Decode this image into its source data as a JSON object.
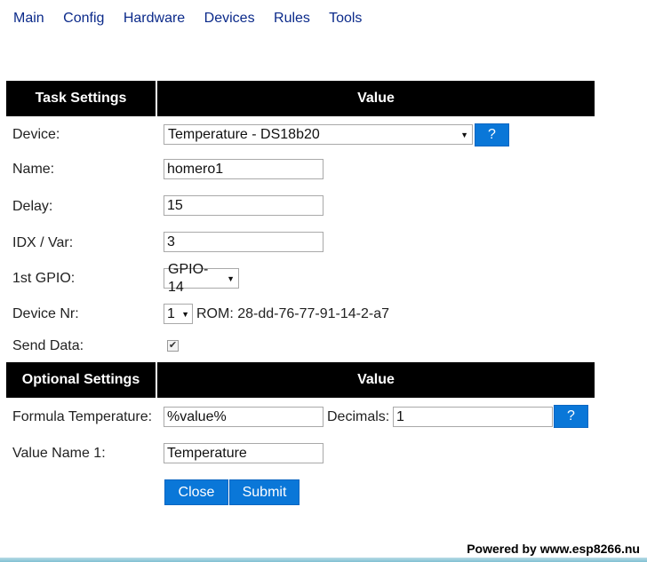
{
  "nav": [
    "Main",
    "Config",
    "Hardware",
    "Devices",
    "Rules",
    "Tools"
  ],
  "task_header": {
    "left": "Task Settings",
    "right": "Value"
  },
  "device": {
    "label": "Device:",
    "value": "Temperature - DS18b20",
    "help": "?"
  },
  "name": {
    "label": "Name:",
    "value": "homero1"
  },
  "delay": {
    "label": "Delay:",
    "value": "15"
  },
  "idx": {
    "label": "IDX / Var:",
    "value": "3"
  },
  "gpio": {
    "label": "1st GPIO:",
    "value": "GPIO-14"
  },
  "device_nr": {
    "label": "Device Nr:",
    "value": "1",
    "rom": "ROM: 28-dd-76-77-91-14-2-a7"
  },
  "send_data": {
    "label": "Send Data:",
    "checked": true,
    "mark": "✔"
  },
  "optional_header": {
    "left": "Optional Settings",
    "right": "Value"
  },
  "formula": {
    "label": "Formula Temperature:",
    "value": "%value%",
    "decimals_label": "Decimals:",
    "decimals_value": "1",
    "help": "?"
  },
  "value_name": {
    "label": "Value Name 1:",
    "value": "Temperature"
  },
  "buttons": {
    "close": "Close",
    "submit": "Submit"
  },
  "footer": "Powered by www.esp8266.nu",
  "colors": {
    "accent": "#0a77d8",
    "header_bg": "#000000",
    "link": "#0b2a8a"
  }
}
